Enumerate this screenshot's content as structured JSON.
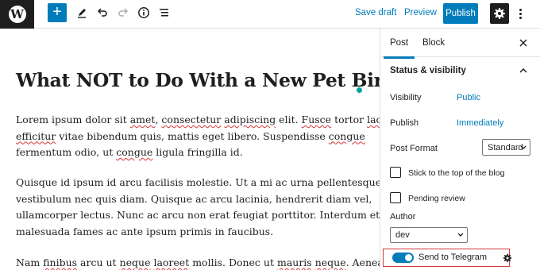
{
  "toolbar": {
    "logo_letter": "W",
    "inserter_symbol": "+",
    "tool_icons": [
      "plus-icon",
      "pencil-icon",
      "undo-icon",
      "redo-icon",
      "info-icon",
      "list-view-icon"
    ],
    "save_draft": "Save draft",
    "preview": "Preview",
    "publish": "Publish"
  },
  "post": {
    "title": "What NOT to Do With a New Pet Bird",
    "paragraphs": [
      [
        [
          {
            "t": "Lorem ipsum dolor sit "
          },
          {
            "t": "amet",
            "sp": true
          },
          {
            "t": ", "
          },
          {
            "t": "consectetur",
            "sp": true
          },
          {
            "t": " "
          },
          {
            "t": "adipiscing",
            "sp": true
          },
          {
            "t": " elit. "
          },
          {
            "t": "Fusce",
            "sp": true
          },
          {
            "t": " tortor "
          },
          {
            "t": "lacus",
            "sp": true
          },
          {
            "t": ","
          }
        ],
        [
          {
            "t": "efficitur",
            "sp": true
          },
          {
            "t": " vitae bibendum quis, mattis eget libero. Suspendisse "
          },
          {
            "t": "congue",
            "sp": true
          }
        ],
        [
          {
            "t": "fermentum odio, ut "
          },
          {
            "t": "congue",
            "sp": true
          },
          {
            "t": " ligula fringilla id."
          }
        ]
      ],
      [
        [
          {
            "t": "Quisque id ipsum id arcu facilisis molestie. Ut a mi ac urna pellentesque"
          }
        ],
        [
          {
            "t": "vestibulum nec quis diam. Quisque ac arcu lacinia, hendrerit diam vel,"
          }
        ],
        [
          {
            "t": "ullamcorper lectus. Nunc ac arcu non erat feugiat porttitor. Interdum et"
          }
        ],
        [
          {
            "t": "malesuada fames ac ante ipsum primis in faucibus."
          }
        ]
      ],
      [
        [
          {
            "t": "Nam "
          },
          {
            "t": "finibus",
            "sp": true
          },
          {
            "t": " arcu ut "
          },
          {
            "t": "neque",
            "sp": true
          },
          {
            "t": " "
          },
          {
            "t": "laoreet",
            "sp": true
          },
          {
            "t": " mollis. Donec ut "
          },
          {
            "t": "mauris",
            "sp": true
          },
          {
            "t": " "
          },
          {
            "t": "neque",
            "sp": true
          },
          {
            "t": ". Aenean"
          }
        ]
      ]
    ]
  },
  "sidebar": {
    "tabs": [
      "Post",
      "Block"
    ],
    "active_tab": "Post",
    "panel_title": "Status & visibility",
    "visibility_label": "Visibility",
    "visibility_value": "Public",
    "publish_label": "Publish",
    "publish_value": "Immediately",
    "post_format_label": "Post Format",
    "post_format_value": "Standard",
    "sticky_label": "Stick to the top of the blog",
    "sticky_checked": false,
    "pending_label": "Pending review",
    "pending_checked": false,
    "author_label": "Author",
    "author_value": "dev",
    "telegram_label": "Send to Telegram",
    "telegram_enabled": true
  },
  "colors": {
    "accent": "#007cba",
    "dark": "#1e1e1e",
    "highlight_border": "#d63638",
    "title_dot": "#00a0a0"
  }
}
